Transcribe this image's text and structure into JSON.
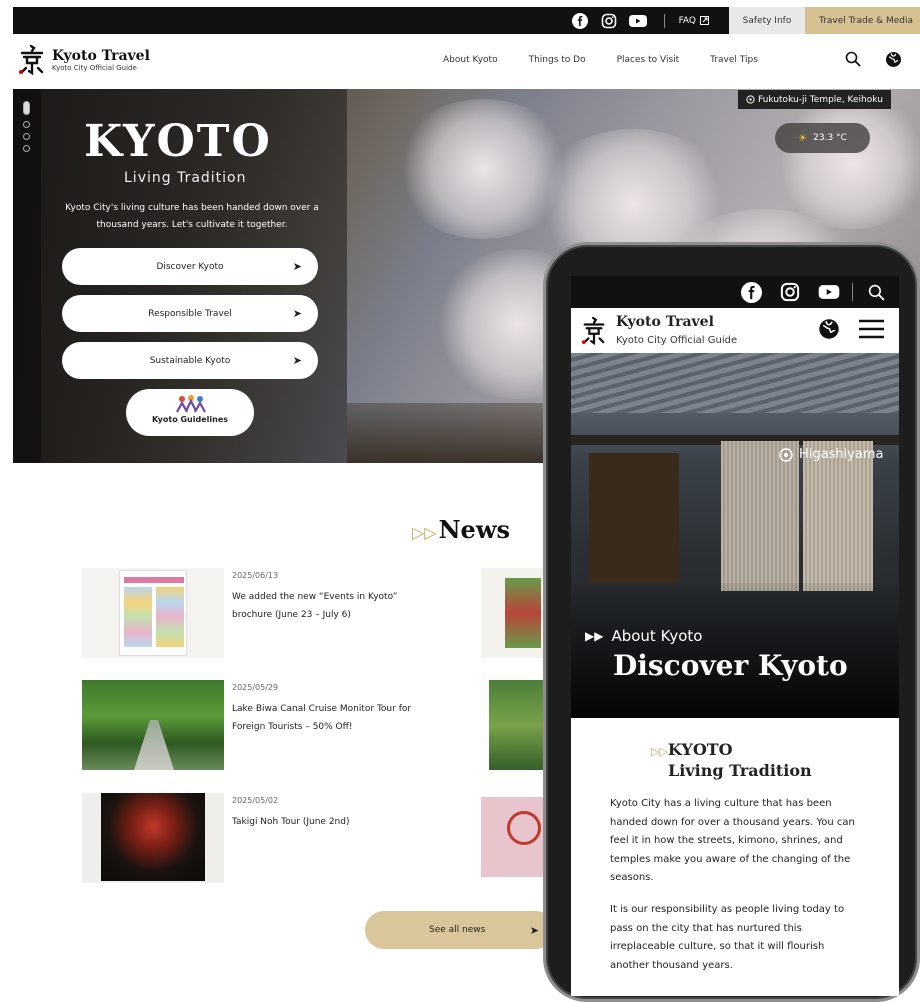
{
  "topbar": {
    "faq": "FAQ",
    "safety": "Safety Info",
    "trade": "Travel Trade & Media",
    "icons": [
      "facebook-icon",
      "instagram-icon",
      "youtube-icon"
    ]
  },
  "header": {
    "title": "Kyoto Travel",
    "subtitle": "Kyoto City Official Guide",
    "nav": [
      "About Kyoto",
      "Things to Do",
      "Places to Visit",
      "Travel Tips"
    ]
  },
  "hero": {
    "kyoto": "KYOTO",
    "living": "Living Tradition",
    "intro": "Kyoto City's living culture has been handed down over a thousand years. Let's cultivate it together.",
    "buttons": [
      "Discover Kyoto",
      "Responsible Travel",
      "Sustainable Kyoto"
    ],
    "guidelines": "Kyoto Guidelines",
    "location": "Fukutoku-ji Temple, Keihoku",
    "temperature": "23.3 °C"
  },
  "news": {
    "heading": "News",
    "items": [
      {
        "date": "2025/06/13",
        "title": "We added the new “Events in Kyoto” brochure (June 23 – July 6)"
      },
      {
        "date": "2025/05/29",
        "title": "Lake Biwa Canal Cruise Monitor Tour for Foreign Tourists – 50% Off!"
      },
      {
        "date": "2025/05/02",
        "title": "Takigi Noh Tour (June 2nd)"
      }
    ],
    "see_all": "See all news"
  },
  "phone": {
    "title": "Kyoto Travel",
    "subtitle": "Kyoto City Official Guide",
    "location": "Higashiyama",
    "about": "About Kyoto",
    "discover": "Discover Kyoto",
    "section_h1": "KYOTO",
    "section_h2": "Living Tradition",
    "para1": "Kyoto City has a living culture that has been handed down for over a thousand years. You can feel it in how the streets, kimono, shrines, and temples make you aware of the changing of the seasons.",
    "para2": "It is our responsibility as people living today to pass on the city that has nurtured this irreplaceable culture, so that it will flourish another thousand years."
  },
  "colors": {
    "accent": "#d6c290",
    "see_all_bg": "#d9c79b",
    "mark": "#c9a65a",
    "topbar": "#111111"
  }
}
